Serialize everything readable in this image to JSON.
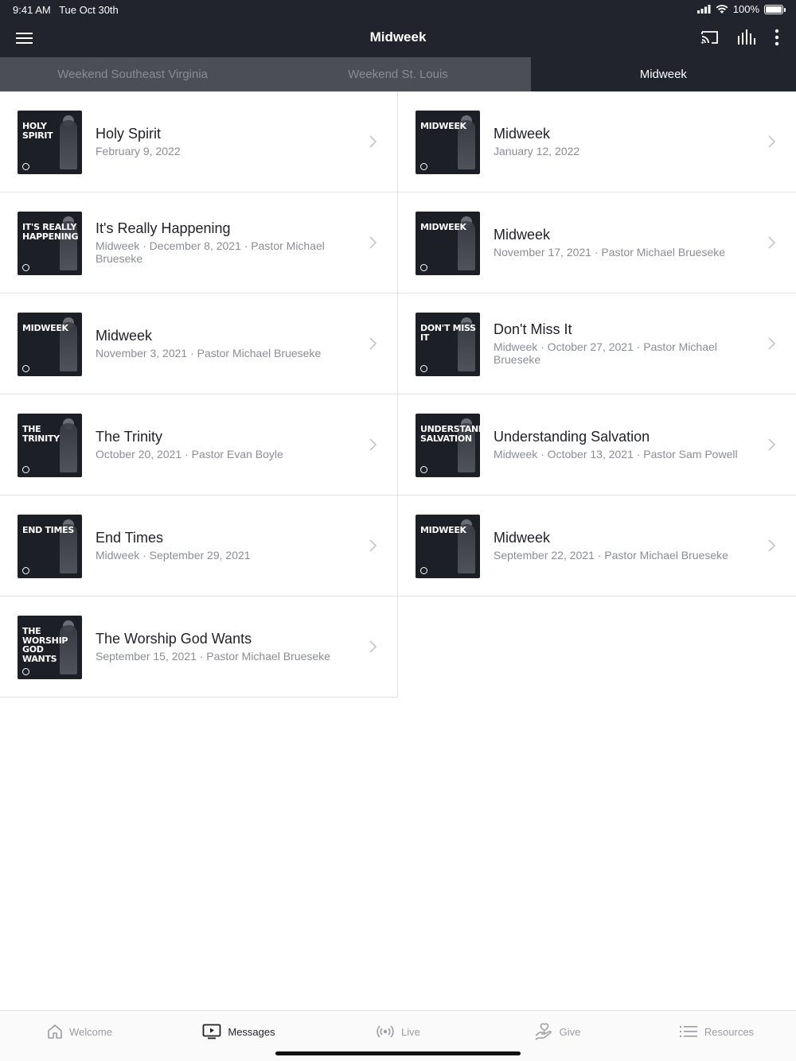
{
  "status": {
    "time": "9:41 AM",
    "date": "Tue Oct 30th",
    "battery": "100%"
  },
  "header": {
    "title": "Midweek"
  },
  "tabs": [
    {
      "label": "Weekend Southeast Virginia",
      "active": false
    },
    {
      "label": "Weekend St. Louis",
      "active": false
    },
    {
      "label": "Midweek",
      "active": true
    }
  ],
  "messages": [
    {
      "title": "Holy Spirit",
      "meta": "February 9, 2022",
      "thumb_text": "HOLY SPIRIT"
    },
    {
      "title": "Midweek",
      "meta": "January 12, 2022",
      "thumb_text": "MIDWEEK"
    },
    {
      "title": "It's Really Happening",
      "meta": "Midweek · December 8, 2021 · Pastor Michael Brueseke",
      "thumb_text": "IT'S REALLY HAPPENING"
    },
    {
      "title": "Midweek",
      "meta": "November 17, 2021 · Pastor Michael Brueseke",
      "thumb_text": "MIDWEEK"
    },
    {
      "title": "Midweek",
      "meta": "November 3, 2021 · Pastor Michael Brueseke",
      "thumb_text": "MIDWEEK"
    },
    {
      "title": "Don't Miss It",
      "meta": "Midweek · October 27, 2021 · Pastor Michael Brueseke",
      "thumb_text": "DON'T MISS IT"
    },
    {
      "title": "The Trinity",
      "meta": "October 20, 2021 · Pastor Evan Boyle",
      "thumb_text": "THE TRINITY"
    },
    {
      "title": "Understanding Salvation",
      "meta": "Midweek · October 13, 2021 · Pastor Sam Powell",
      "thumb_text": "UNDERSTANDING SALVATION"
    },
    {
      "title": "End Times",
      "meta": "Midweek · September 29, 2021",
      "thumb_text": "END TIMES"
    },
    {
      "title": "Midweek",
      "meta": "September 22, 2021 · Pastor Michael Brueseke",
      "thumb_text": "MIDWEEK"
    },
    {
      "title": "The Worship God Wants",
      "meta": "September 15, 2021 · Pastor Michael Brueseke",
      "thumb_text": "THE WORSHIP GOD WANTS"
    }
  ],
  "tabbar": [
    {
      "label": "Welcome",
      "icon": "home-icon",
      "active": false
    },
    {
      "label": "Messages",
      "icon": "tv-icon",
      "active": true
    },
    {
      "label": "Live",
      "icon": "broadcast-icon",
      "active": false
    },
    {
      "label": "Give",
      "icon": "give-hand-icon",
      "active": false
    },
    {
      "label": "Resources",
      "icon": "list-icon",
      "active": false
    }
  ],
  "colors": {
    "bar": "#21242c",
    "tabs_bg": "#4b4e56",
    "muted": "#8a8d94",
    "text": "#1f2127"
  }
}
